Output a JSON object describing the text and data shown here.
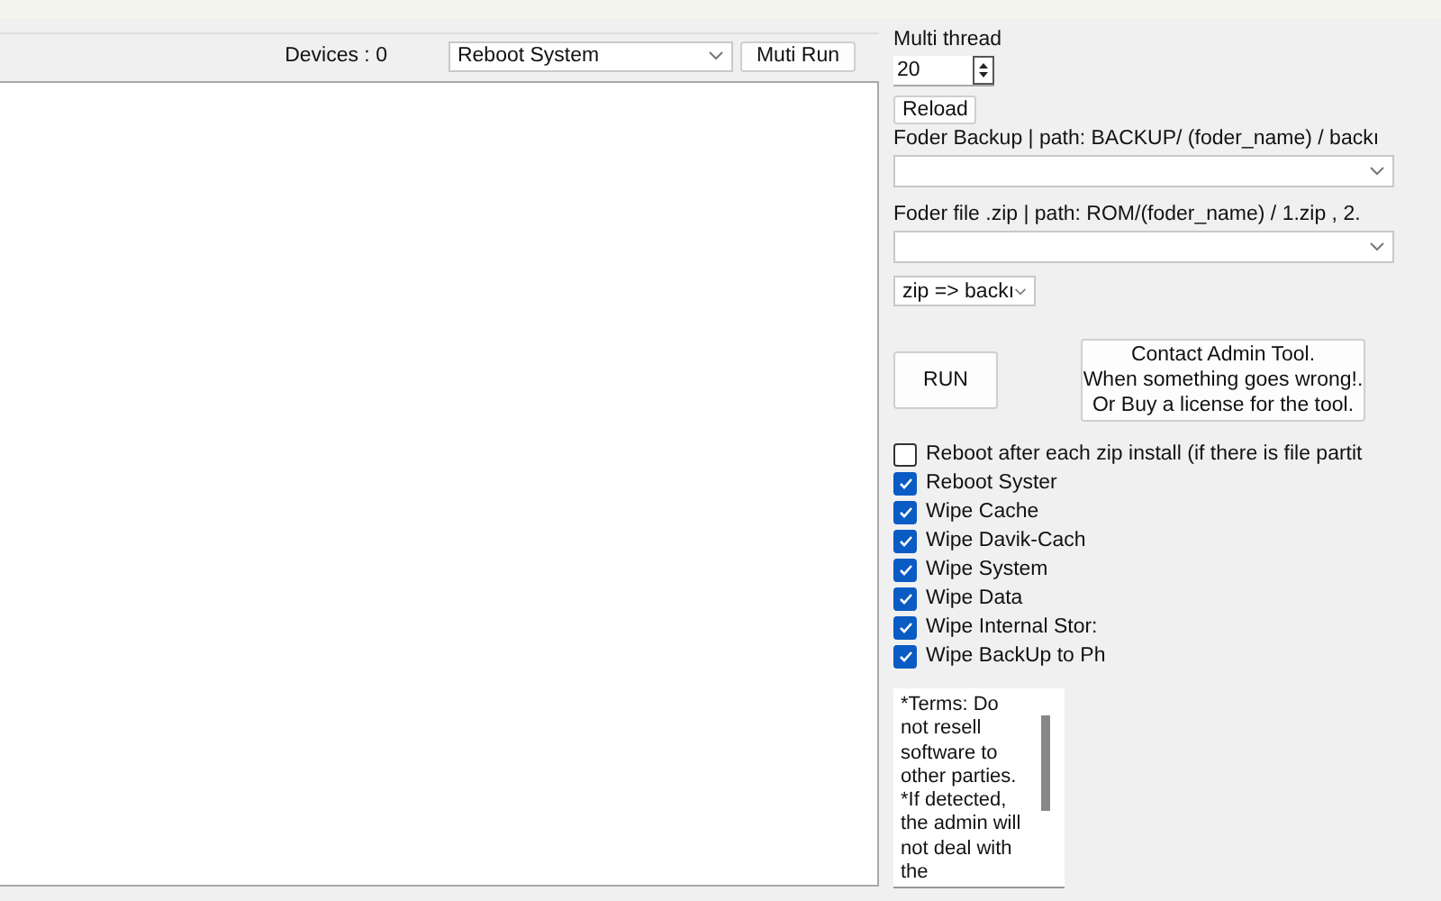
{
  "toolbar": {
    "devices_label": "Devices : 0",
    "mode_select": {
      "value": "Reboot System"
    },
    "muti_run_button": "Muti Run"
  },
  "settings": {
    "multi_thread_label": "Multi thread",
    "thread_count": {
      "value": "20"
    },
    "reload_button": "Reload",
    "backup_folder_label": "Foder Backup | path: BACKUP/ (foder_name) / backı",
    "zip_folder_label": "Foder file .zip | path: ROM/(foder_name) / 1.zip , 2.",
    "direction_select": {
      "value": "zip => backı"
    },
    "run_button": "RUN",
    "contact_button": [
      "Contact Admin Tool.",
      "When something goes wrong!.",
      "Or Buy a license for the tool."
    ],
    "options": [
      {
        "label": "Reboot after each zip install (if there is file partit",
        "checked": false
      },
      {
        "label": "Reboot Syster",
        "checked": true
      },
      {
        "label": "Wipe Cache",
        "checked": true
      },
      {
        "label": "Wipe Davik-Cach",
        "checked": true
      },
      {
        "label": "Wipe System",
        "checked": true
      },
      {
        "label": "Wipe Data",
        "checked": true
      },
      {
        "label": "Wipe Internal Stor:",
        "checked": true
      },
      {
        "label": "Wipe BackUp to Ph",
        "checked": true
      }
    ],
    "terms_text": "*Terms: Do not resell software to other parties. *If detected, the admin will not deal with the"
  }
}
